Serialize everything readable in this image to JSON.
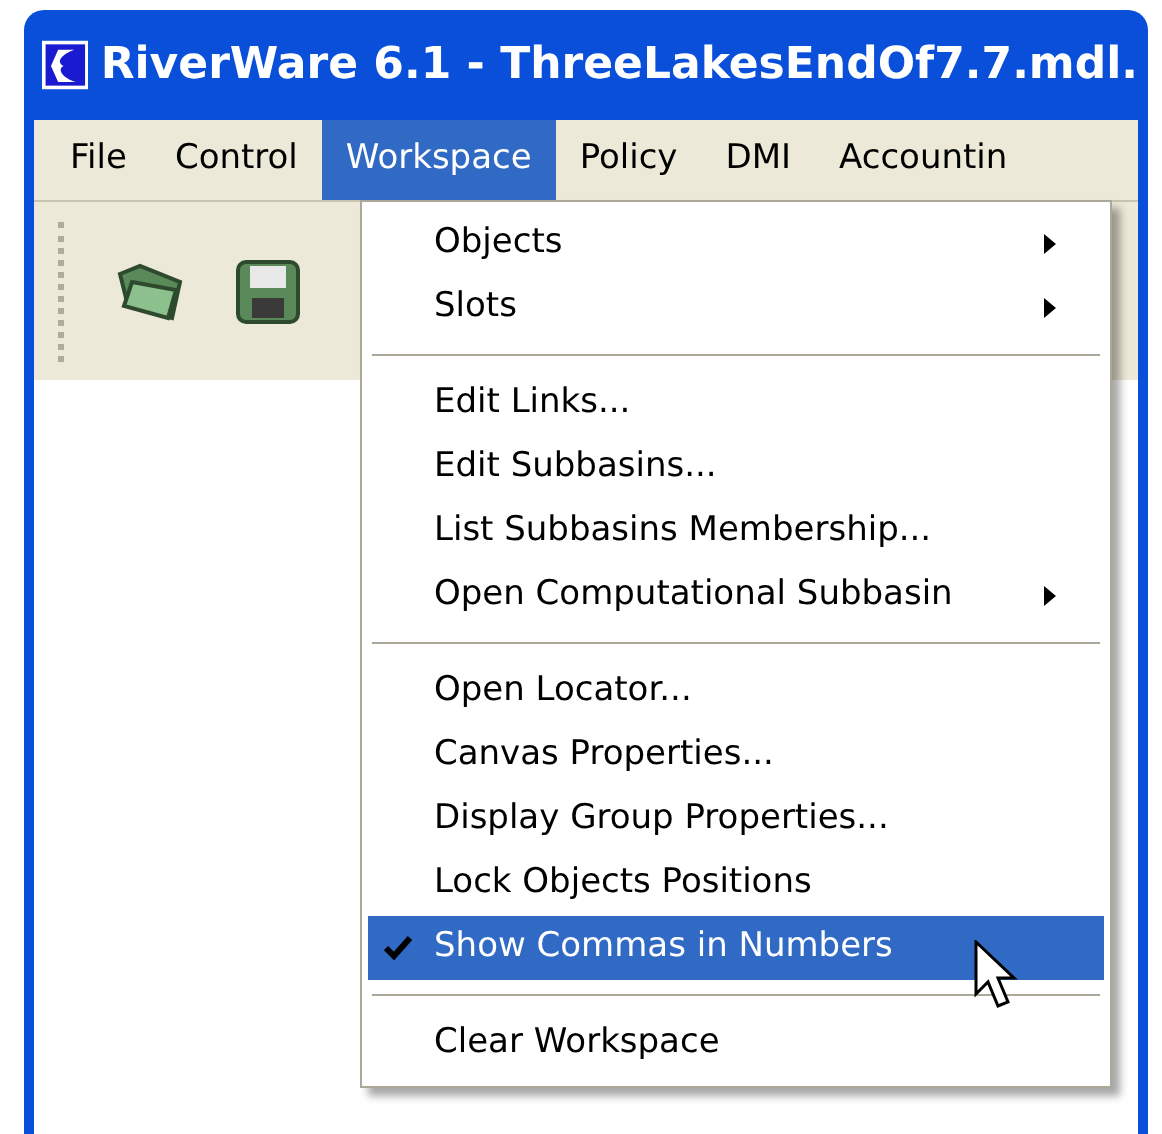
{
  "window": {
    "title": "RiverWare 6.1 - ThreeLakesEndOf7.7.mdl."
  },
  "menubar": [
    {
      "label": "File",
      "selected": false
    },
    {
      "label": "Control",
      "selected": false
    },
    {
      "label": "Workspace",
      "selected": true
    },
    {
      "label": "Policy",
      "selected": false
    },
    {
      "label": "DMI",
      "selected": false
    },
    {
      "label": "Accountin",
      "selected": false
    }
  ],
  "menu": [
    {
      "kind": "item",
      "label": "Objects",
      "submenu": true,
      "checked": false,
      "selected": false
    },
    {
      "kind": "item",
      "label": "Slots",
      "submenu": true,
      "checked": false,
      "selected": false
    },
    {
      "kind": "separator"
    },
    {
      "kind": "item",
      "label": "Edit Links...",
      "submenu": false,
      "checked": false,
      "selected": false
    },
    {
      "kind": "item",
      "label": "Edit Subbasins...",
      "submenu": false,
      "checked": false,
      "selected": false
    },
    {
      "kind": "item",
      "label": "List Subbasins Membership...",
      "submenu": false,
      "checked": false,
      "selected": false
    },
    {
      "kind": "item",
      "label": "Open Computational Subbasin",
      "submenu": true,
      "checked": false,
      "selected": false
    },
    {
      "kind": "separator"
    },
    {
      "kind": "item",
      "label": "Open Locator...",
      "submenu": false,
      "checked": false,
      "selected": false
    },
    {
      "kind": "item",
      "label": "Canvas Properties...",
      "submenu": false,
      "checked": false,
      "selected": false
    },
    {
      "kind": "item",
      "label": "Display Group Properties...",
      "submenu": false,
      "checked": false,
      "selected": false
    },
    {
      "kind": "item",
      "label": "Lock Objects Positions",
      "submenu": false,
      "checked": false,
      "selected": false
    },
    {
      "kind": "item",
      "label": "Show Commas in Numbers",
      "submenu": false,
      "checked": true,
      "selected": true
    },
    {
      "kind": "separator"
    },
    {
      "kind": "item",
      "label": "Clear Workspace",
      "submenu": false,
      "checked": false,
      "selected": false
    }
  ]
}
